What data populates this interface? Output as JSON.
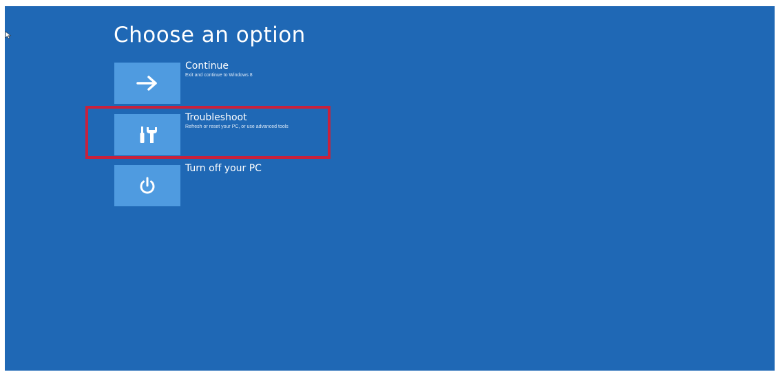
{
  "page": {
    "title": "Choose an option"
  },
  "options": [
    {
      "title": "Continue",
      "description": "Exit and continue to Windows 8",
      "icon": "arrow-right-icon"
    },
    {
      "title": "Troubleshoot",
      "description": "Refresh or reset your PC, or use advanced tools",
      "icon": "tools-icon",
      "highlighted": true
    },
    {
      "title": "Turn off your PC",
      "description": "",
      "icon": "power-icon"
    }
  ],
  "colors": {
    "background": "#1f68b5",
    "tile": "#4f9be0",
    "highlight": "#c8213c",
    "text": "#ffffff"
  }
}
